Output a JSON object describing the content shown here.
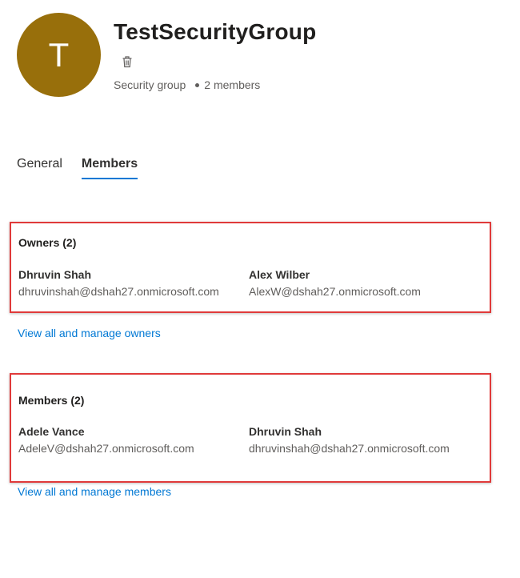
{
  "group": {
    "avatar_initial": "T",
    "avatar_color": "#986f0b",
    "name": "TestSecurityGroup",
    "delete_icon": "trash-icon",
    "type": "Security group",
    "member_count": "2 members"
  },
  "tabs": [
    {
      "label": "General",
      "active": false
    },
    {
      "label": "Members",
      "active": true
    }
  ],
  "owners": {
    "title": "Owners (2)",
    "people": [
      {
        "name": "Dhruvin Shah",
        "email": "dhruvinshah@dshah27.onmicrosoft.com"
      },
      {
        "name": "Alex Wilber",
        "email": "AlexW@dshah27.onmicrosoft.com"
      }
    ],
    "link": "View all and manage owners"
  },
  "members": {
    "title": "Members (2)",
    "people": [
      {
        "name": "Adele Vance",
        "email": "AdeleV@dshah27.onmicrosoft.com"
      },
      {
        "name": "Dhruvin Shah",
        "email": "dhruvinshah@dshah27.onmicrosoft.com"
      }
    ],
    "link": "View all and manage members"
  },
  "colors": {
    "accent": "#0078d4",
    "highlight_border": "#e03a3a"
  }
}
